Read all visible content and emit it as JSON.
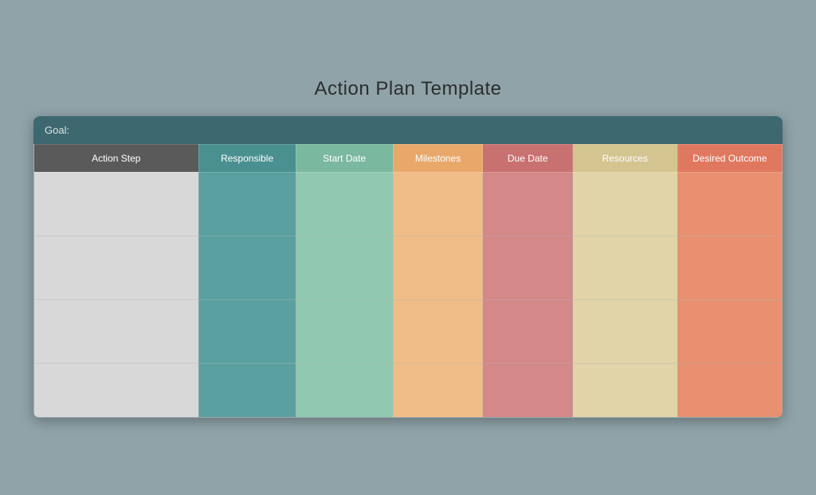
{
  "page": {
    "title": "Action Plan Template",
    "goal_label": "Goal:",
    "columns": [
      {
        "id": "action",
        "label": "Action Step"
      },
      {
        "id": "responsible",
        "label": "Responsible"
      },
      {
        "id": "startdate",
        "label": "Start Date"
      },
      {
        "id": "milestones",
        "label": "Milestones"
      },
      {
        "id": "duedate",
        "label": "Due Date"
      },
      {
        "id": "resources",
        "label": "Resources"
      },
      {
        "id": "outcome",
        "label": "Desired Outcome"
      }
    ],
    "rows": 4
  }
}
